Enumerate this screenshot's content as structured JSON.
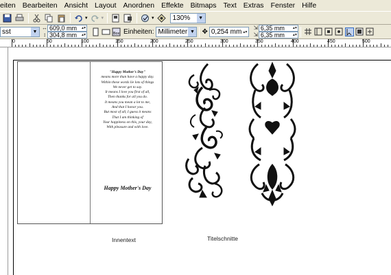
{
  "menubar": {
    "items": [
      "eiten",
      "Bearbeiten",
      "Ansicht",
      "Layout",
      "Anordnen",
      "Effekte",
      "Bitmaps",
      "Text",
      "Extras",
      "Fenster",
      "Hilfe"
    ]
  },
  "toolbar": {
    "zoom": "130%"
  },
  "propertybar": {
    "paper_preset": "sst",
    "width": "609,0 mm",
    "height": "304,8 mm",
    "units_label": "Einheiten:",
    "units_value": "Millimeter",
    "nudge": "0,254 mm",
    "dup_x": "6,35 mm",
    "dup_y": "6,35 mm"
  },
  "ruler": {
    "labels": [
      "0",
      "50",
      "100",
      "150",
      "200",
      "250",
      "300",
      "350",
      "400",
      "450",
      "500"
    ]
  },
  "document": {
    "poem_lines": [
      "\"Happy Mother's Day\"",
      "means more than have a happy day.",
      "Within these words lie lots of things",
      "We never get to say.",
      "It means I love you first of all,",
      "Then thanks for all you do.",
      "It means you mean a lot to me,",
      "And that I honor you.",
      "But most of all, I guess it means",
      "That I am thinking of",
      "Your happiness on this, your day,",
      "With pleasure and with love."
    ],
    "card_signature": "Happy Mother's Day",
    "caption_inside": "Innentext",
    "caption_title": "Titelschnitte"
  },
  "colors": {
    "chrome": "#ece9d8",
    "field_border": "#7f9db9",
    "ink": "#111111"
  }
}
